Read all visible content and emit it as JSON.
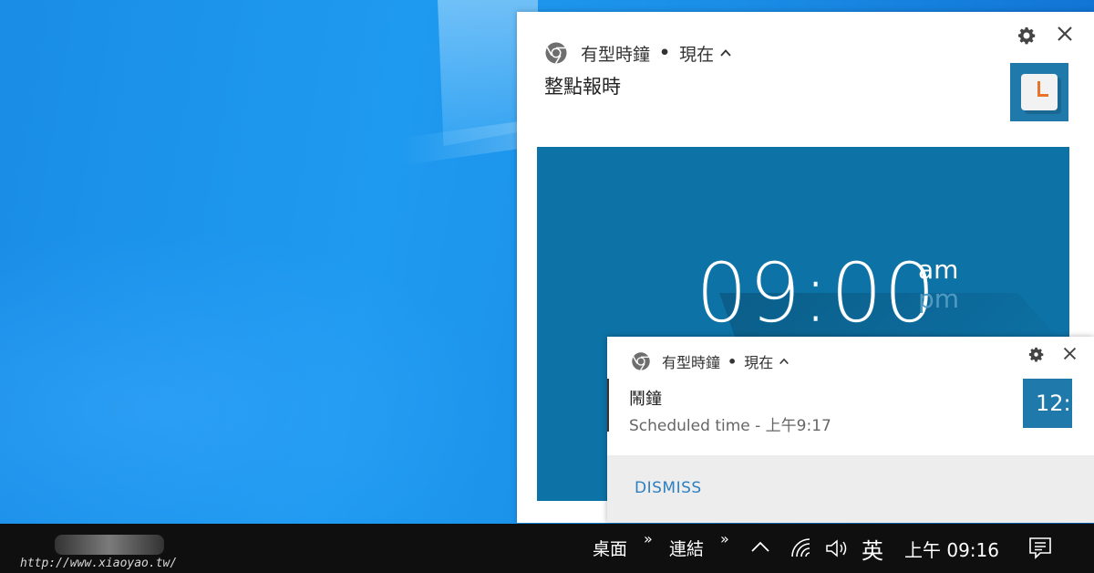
{
  "notification_main": {
    "app_name": "有型時鐘",
    "time": "現在",
    "title": "整點報時",
    "image": {
      "clock_time": "09:00",
      "am_label": "am",
      "pm_label": "pm"
    }
  },
  "notification_alarm": {
    "app_name": "有型時鐘",
    "time": "現在",
    "title": "鬧鐘",
    "body": "Scheduled time - 上午9:17",
    "icon_text": "12:",
    "dismiss_label": "DISMISS"
  },
  "taskbar": {
    "watermark_url": "http://www.xiaoyao.tw/",
    "toolbar_desktop": "桌面",
    "toolbar_links": "連結",
    "chevron": "»",
    "ime_label": "英",
    "clock": "上午 09:16"
  },
  "colors": {
    "accent_blue": "#1f79ab",
    "dismiss_blue": "#2e7fc0",
    "taskbar": "#0f0f10",
    "alarm_hand": "#e8742c"
  },
  "icons": [
    "chrome-icon",
    "chevron-up-icon",
    "gear-icon",
    "close-icon",
    "clock-app-icon",
    "wifi-icon",
    "volume-icon",
    "action-center-icon",
    "tray-up-icon"
  ]
}
